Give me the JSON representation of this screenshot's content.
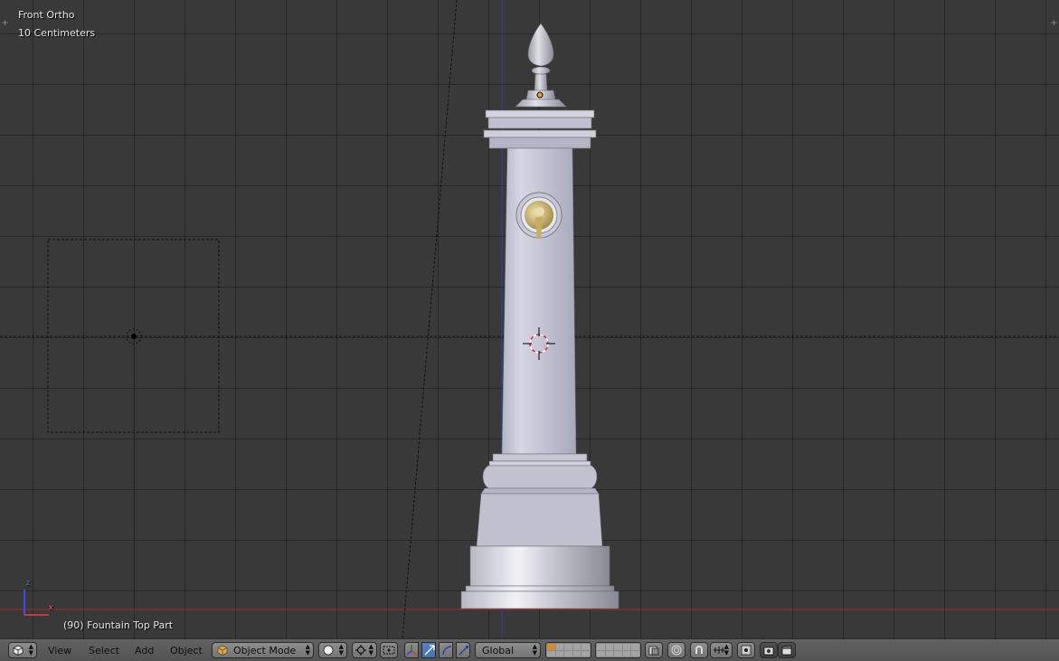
{
  "viewport": {
    "view_name": "Front Ortho",
    "grid_scale": "10 Centimeters",
    "object_info": "(90) Fountain Top Part",
    "axis_labels": {
      "z": "z",
      "x": "x"
    }
  },
  "header": {
    "editor_type_icon": "3d-view-icon",
    "menus": {
      "view": "View",
      "select": "Select",
      "add": "Add",
      "object": "Object"
    },
    "mode": "Object Mode",
    "pivot_icon": "pivot-point-icon",
    "orientation": "Global",
    "icons": [
      "manipulator-icon",
      "translate-icon",
      "rotate-icon",
      "scale-icon",
      "layers-icon",
      "proportional-edit-icon",
      "snap-icon",
      "render-icon"
    ]
  },
  "colors": {
    "viewport_bg": "#393939",
    "header_bg": "#5a5a5a",
    "x_axis": "#b03030",
    "y_axis": "#3a3aa8",
    "active_blue": "#5680c2"
  }
}
